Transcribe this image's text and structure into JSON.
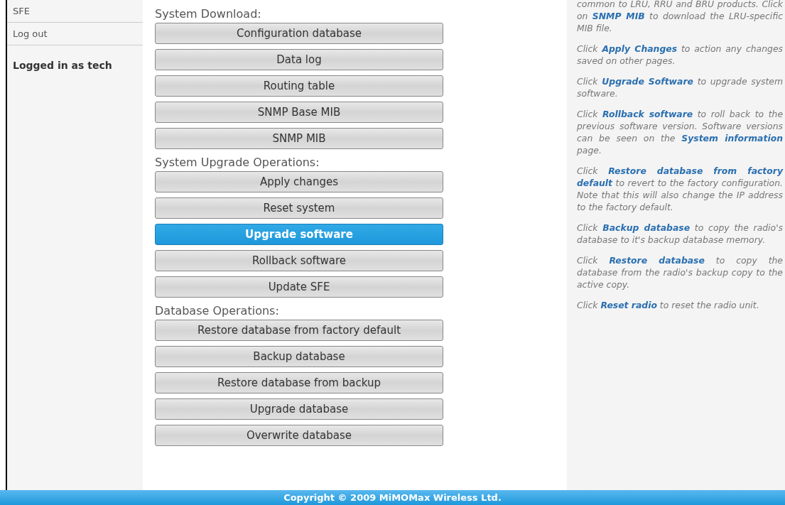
{
  "sidebar": {
    "items": [
      {
        "label": "SFE"
      },
      {
        "label": "Log out"
      }
    ],
    "login_status": "Logged in as tech"
  },
  "sections": [
    {
      "title": "System Download:",
      "buttons": [
        {
          "label": "Configuration database",
          "selected": false
        },
        {
          "label": "Data log",
          "selected": false
        },
        {
          "label": "Routing table",
          "selected": false
        },
        {
          "label": "SNMP Base MIB",
          "selected": false
        },
        {
          "label": "SNMP MIB",
          "selected": false
        }
      ]
    },
    {
      "title": "System Upgrade Operations:",
      "buttons": [
        {
          "label": "Apply changes",
          "selected": false
        },
        {
          "label": "Reset system",
          "selected": false
        },
        {
          "label": "Upgrade software",
          "selected": true
        },
        {
          "label": "Rollback software",
          "selected": false
        },
        {
          "label": "Update SFE",
          "selected": false
        }
      ]
    },
    {
      "title": "Database Operations:",
      "buttons": [
        {
          "label": "Restore database from factory default",
          "selected": false
        },
        {
          "label": "Backup database",
          "selected": false
        },
        {
          "label": "Restore database from backup",
          "selected": false
        },
        {
          "label": "Upgrade database",
          "selected": false
        },
        {
          "label": "Overwrite database",
          "selected": false
        }
      ]
    }
  ],
  "help": [
    "common to LRU, RRU and BRU products. Click on **SNMP MIB** to download the LRU-specific MIB file.",
    "Click **Apply Changes** to action any changes saved on other pages.",
    "Click **Upgrade Software** to upgrade system software.",
    "Click **Rollback software** to roll back to the previous software version. Software versions can be seen on the **System information** page.",
    "Click **Restore database from factory default** to revert to the factory configuration. Note that this will also change the IP address to the factory default.",
    "Click **Backup database** to copy the radio's database to it's backup database memory.",
    "Click **Restore database** to copy the database from the radio's backup copy to the active copy.",
    "Click **Reset radio** to reset the radio unit."
  ],
  "footer": "Copyright © 2009 MiMOMax Wireless Ltd."
}
